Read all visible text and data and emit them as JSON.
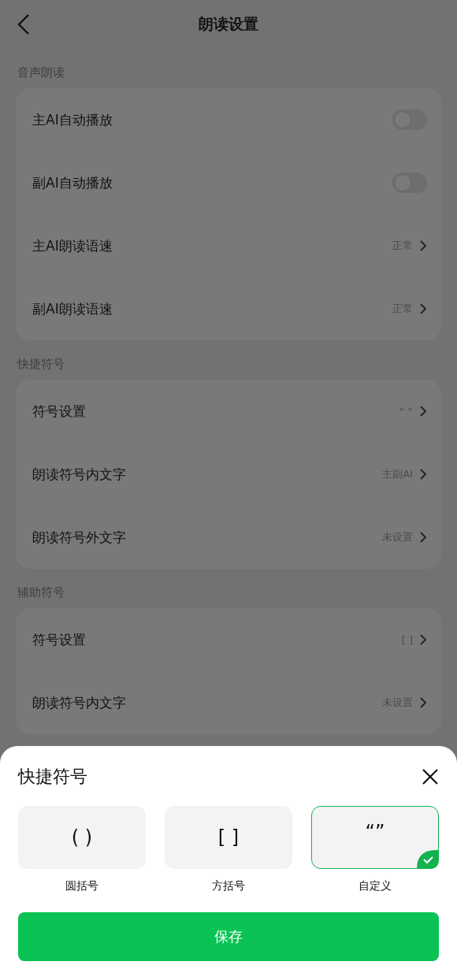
{
  "header": {
    "title": "朗读设置"
  },
  "sections": [
    {
      "title": "音声朗读",
      "rows": [
        {
          "kind": "toggle",
          "label": "主AI自动播放",
          "on": false
        },
        {
          "kind": "toggle",
          "label": "副AI自动播放",
          "on": false
        },
        {
          "kind": "link",
          "label": "主AI朗读语速",
          "value": "正常"
        },
        {
          "kind": "link",
          "label": "副AI朗读语速",
          "value": "正常"
        }
      ]
    },
    {
      "title": "快捷符号",
      "rows": [
        {
          "kind": "link",
          "label": "符号设置",
          "value": "“ ”"
        },
        {
          "kind": "link",
          "label": "朗读符号内文字",
          "value": "主副AI"
        },
        {
          "kind": "link",
          "label": "朗读符号外文字",
          "value": "未设置"
        }
      ]
    },
    {
      "title": "辅助符号",
      "rows": [
        {
          "kind": "link",
          "label": "符号设置",
          "value": "[ ]"
        },
        {
          "kind": "link",
          "label": "朗读符号内文字",
          "value": "未设置"
        }
      ]
    }
  ],
  "sheet": {
    "title": "快捷符号",
    "options": [
      {
        "symbol": "( )",
        "label": "圆括号",
        "selected": false
      },
      {
        "symbol": "[ ]",
        "label": "方括号",
        "selected": false
      },
      {
        "symbol": "“”",
        "label": "自定义",
        "selected": true
      }
    ],
    "save": "保存"
  }
}
